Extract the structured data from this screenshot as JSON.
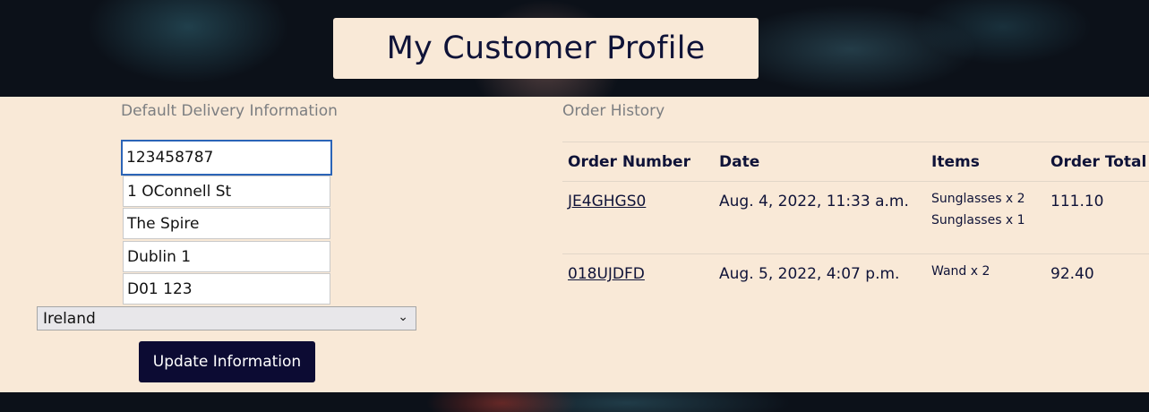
{
  "page": {
    "title": "My Customer Profile"
  },
  "delivery": {
    "heading": "Default Delivery Information",
    "fields": {
      "phone": "123458787",
      "address1": "1 OConnell St",
      "address2": "The Spire",
      "city": "Dublin 1",
      "postcode": "D01 123"
    },
    "country": "Ireland",
    "update_label": "Update Information"
  },
  "orders": {
    "heading": "Order History",
    "columns": [
      "Order Number",
      "Date",
      "Items",
      "Order Total"
    ],
    "rows": [
      {
        "number": "JE4GHGS0",
        "date": "Aug. 4, 2022, 11:33 a.m.",
        "items": [
          "Sunglasses x 2",
          "Sunglasses x 1"
        ],
        "total": "111.10"
      },
      {
        "number": "018UJDFD",
        "date": "Aug. 5, 2022, 4:07 p.m.",
        "items": [
          "Wand x 2"
        ],
        "total": "92.40"
      }
    ]
  },
  "colors": {
    "panel": "#f9e9d7",
    "navy": "#0f1338",
    "button": "#0c0b33",
    "focus": "#2b64b7"
  }
}
